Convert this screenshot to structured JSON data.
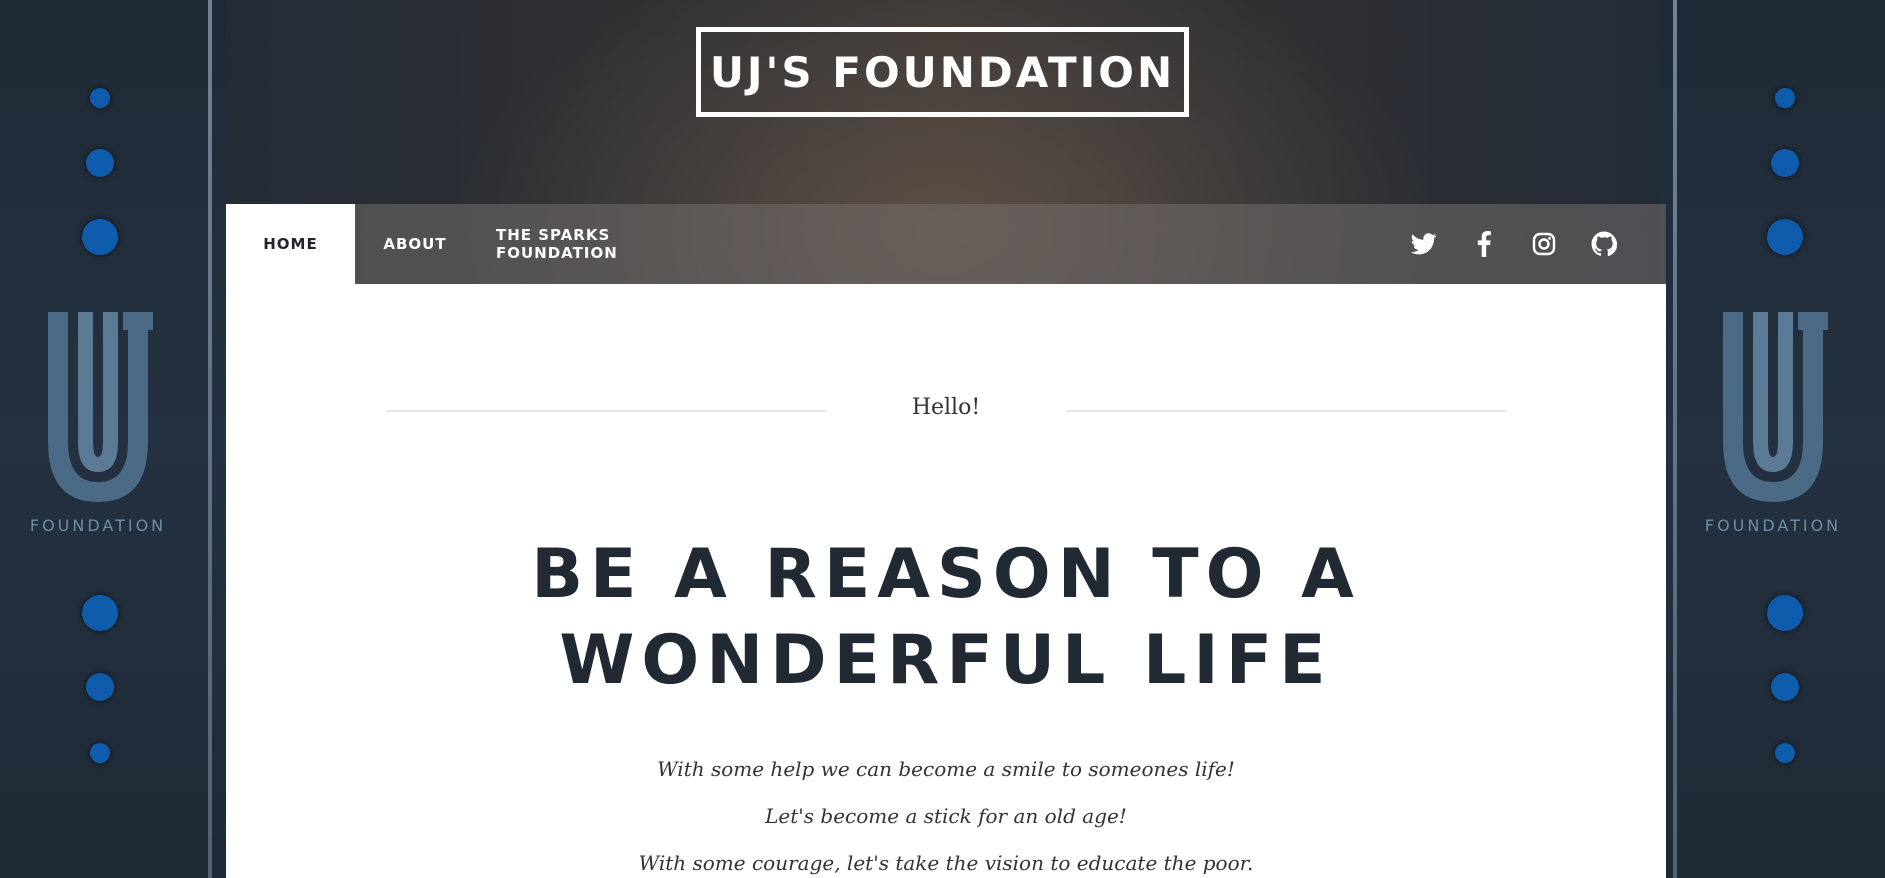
{
  "site": {
    "title": "UJ'S FOUNDATION"
  },
  "decor": {
    "logo_text": "FOUNDATION",
    "dot_color": "#0f5cad"
  },
  "nav": {
    "items": [
      {
        "label": "HOME",
        "active": true
      },
      {
        "label": "ABOUT",
        "active": false
      },
      {
        "label": "THE SPARKS FOUNDATION",
        "active": false
      }
    ],
    "social": [
      "twitter-icon",
      "facebook-icon",
      "instagram-icon",
      "github-icon"
    ]
  },
  "main": {
    "greeting": "Hello!",
    "heading_line1": "BE A REASON TO A",
    "heading_line2": "WONDERFUL LIFE",
    "taglines": [
      "With some help we can become a smile to someones life!",
      "Let's become a stick for an old age!",
      "With some courage, let's take the vision to educate the poor."
    ]
  },
  "colors": {
    "heading": "#212a33",
    "nav_active_bg": "#ffffff"
  }
}
